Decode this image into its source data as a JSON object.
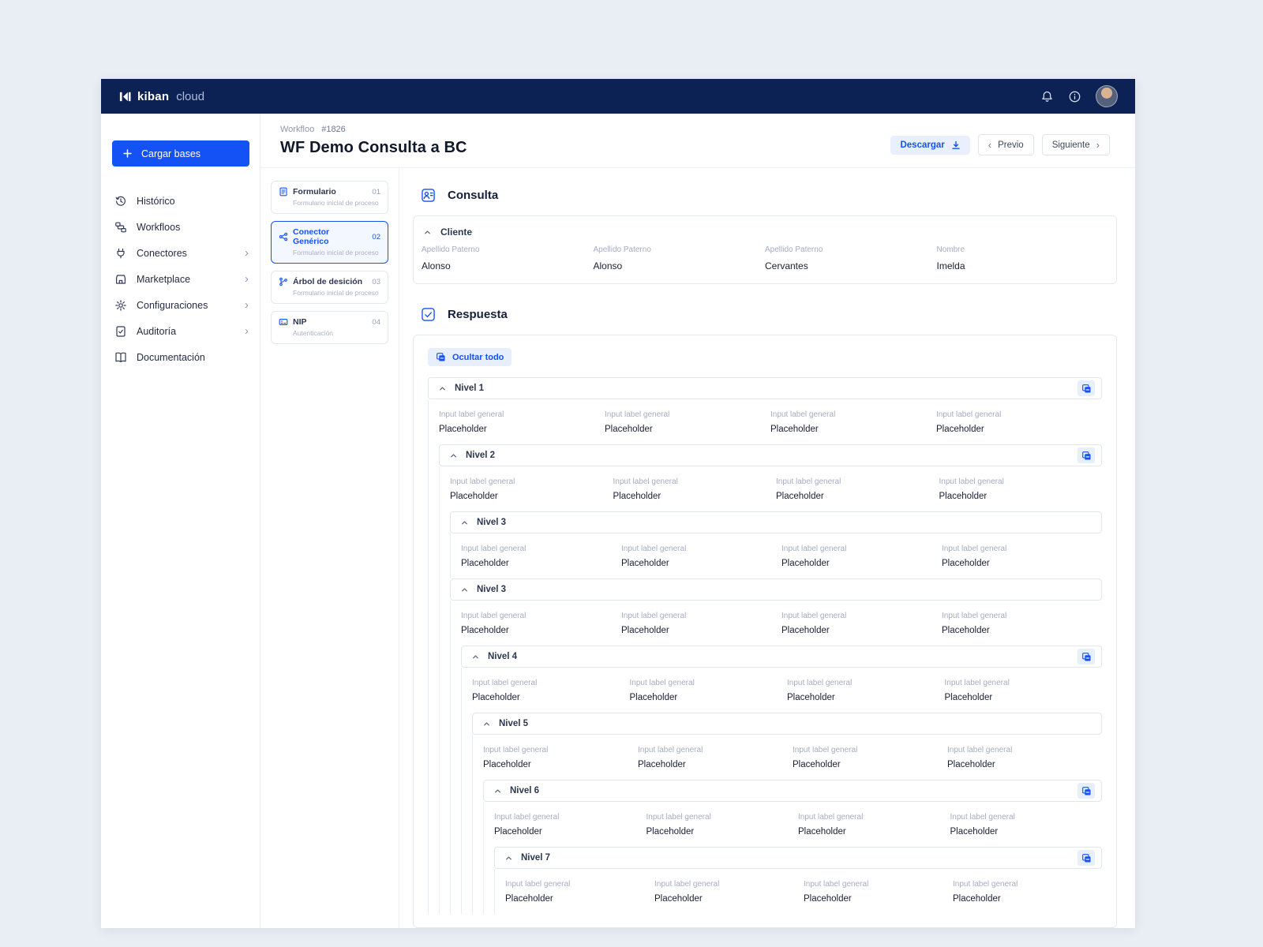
{
  "colors": {
    "accent": "#1452f5",
    "navy": "#0d2254",
    "page-bg": "#e9edf4"
  },
  "navbar": {
    "brand": "kiban",
    "brand_suffix": "cloud"
  },
  "sidebar": {
    "primary_button": "Cargar bases",
    "items": [
      {
        "label": "Histórico",
        "icon": "history-icon",
        "chevron": false
      },
      {
        "label": "Workfloos",
        "icon": "workflow-icon",
        "chevron": false
      },
      {
        "label": "Conectores",
        "icon": "plug-icon",
        "chevron": true
      },
      {
        "label": "Marketplace",
        "icon": "storefront-icon",
        "chevron": true
      },
      {
        "label": "Configuraciones",
        "icon": "gear-icon",
        "chevron": true
      },
      {
        "label": "Auditoría",
        "icon": "audit-check-icon",
        "chevron": true
      },
      {
        "label": "Documentación",
        "icon": "book-icon",
        "chevron": false
      }
    ]
  },
  "header": {
    "breadcrumb": "Workfloo",
    "breadcrumb_id": "#1826",
    "title": "WF Demo Consulta a BC",
    "download_label": "Descargar",
    "prev_label": "Previo",
    "next_label": "Siguiente",
    "prev_chevron": "‹",
    "next_chevron": "›"
  },
  "steps": [
    {
      "title": "Formulario",
      "number": "01",
      "subtitle": "Formulario inicial de proceso",
      "icon": "form-icon",
      "selected": false
    },
    {
      "title": "Conector Genérico",
      "number": "02",
      "subtitle": "Formulario inicial de proceso",
      "icon": "connector-icon",
      "selected": true
    },
    {
      "title": "Árbol de desición",
      "number": "03",
      "subtitle": "Formulario inicial de proceso",
      "icon": "tree-icon",
      "selected": false
    },
    {
      "title": "NIP",
      "number": "04",
      "subtitle": "Autenticación",
      "icon": "nip-icon",
      "selected": false
    }
  ],
  "consulta": {
    "title": "Consulta",
    "card_title": "Cliente",
    "fields": [
      {
        "label": "Apellido Paterno",
        "value": "Alonso"
      },
      {
        "label": "Apellido Paterno",
        "value": "Alonso"
      },
      {
        "label": "Apellido Paterno",
        "value": "Cervantes"
      },
      {
        "label": "Nombre",
        "value": "Imelda"
      }
    ]
  },
  "respuesta": {
    "title": "Respuesta",
    "collapse_all_label": "Ocultar todo",
    "levels": [
      {
        "title": "Nivel 1",
        "copy": true,
        "fields": [
          {
            "label": "Input label general",
            "value": "Placeholder"
          },
          {
            "label": "Input label general",
            "value": "Placeholder"
          },
          {
            "label": "Input label general",
            "value": "Placeholder"
          },
          {
            "label": "Input label general",
            "value": "Placeholder"
          }
        ],
        "children": [
          {
            "title": "Nivel 2",
            "copy": true,
            "fields": [
              {
                "label": "Input label general",
                "value": "Placeholder"
              },
              {
                "label": "Input label general",
                "value": "Placeholder"
              },
              {
                "label": "Input label general",
                "value": "Placeholder"
              },
              {
                "label": "Input label general",
                "value": "Placeholder"
              }
            ],
            "children": [
              {
                "title": "Nivel 3",
                "copy": false,
                "fields": [
                  {
                    "label": "Input label general",
                    "value": "Placeholder"
                  },
                  {
                    "label": "Input label general",
                    "value": "Placeholder"
                  },
                  {
                    "label": "Input label general",
                    "value": "Placeholder"
                  },
                  {
                    "label": "Input label general",
                    "value": "Placeholder"
                  }
                ],
                "children": []
              },
              {
                "title": "Nivel 3",
                "copy": false,
                "fields": [
                  {
                    "label": "Input label general",
                    "value": "Placeholder"
                  },
                  {
                    "label": "Input label general",
                    "value": "Placeholder"
                  },
                  {
                    "label": "Input label general",
                    "value": "Placeholder"
                  },
                  {
                    "label": "Input label general",
                    "value": "Placeholder"
                  }
                ],
                "children": [
                  {
                    "title": "Nivel 4",
                    "copy": true,
                    "fields": [
                      {
                        "label": "Input label general",
                        "value": "Placeholder"
                      },
                      {
                        "label": "Input label general",
                        "value": "Placeholder"
                      },
                      {
                        "label": "Input label general",
                        "value": "Placeholder"
                      },
                      {
                        "label": "Input label general",
                        "value": "Placeholder"
                      }
                    ],
                    "children": [
                      {
                        "title": "Nivel 5",
                        "copy": false,
                        "fields": [
                          {
                            "label": "Input label general",
                            "value": "Placeholder"
                          },
                          {
                            "label": "Input label general",
                            "value": "Placeholder"
                          },
                          {
                            "label": "Input label general",
                            "value": "Placeholder"
                          },
                          {
                            "label": "Input label general",
                            "value": "Placeholder"
                          }
                        ],
                        "children": [
                          {
                            "title": "Nivel 6",
                            "copy": true,
                            "fields": [
                              {
                                "label": "Input label general",
                                "value": "Placeholder"
                              },
                              {
                                "label": "Input label general",
                                "value": "Placeholder"
                              },
                              {
                                "label": "Input label general",
                                "value": "Placeholder"
                              },
                              {
                                "label": "Input label general",
                                "value": "Placeholder"
                              }
                            ],
                            "children": [
                              {
                                "title": "Nivel 7",
                                "copy": true,
                                "fields": [
                                  {
                                    "label": "Input label general",
                                    "value": "Placeholder"
                                  },
                                  {
                                    "label": "Input label general",
                                    "value": "Placeholder"
                                  },
                                  {
                                    "label": "Input label general",
                                    "value": "Placeholder"
                                  },
                                  {
                                    "label": "Input label general",
                                    "value": "Placeholder"
                                  }
                                ],
                                "children": []
                              }
                            ]
                          }
                        ]
                      }
                    ]
                  }
                ]
              }
            ]
          }
        ]
      }
    ]
  }
}
